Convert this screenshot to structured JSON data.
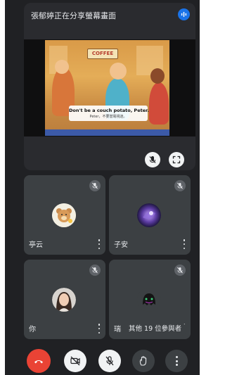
{
  "presentation": {
    "title": "張郁婷正在分享螢幕畫面",
    "shop_sign": "COFFEE",
    "subtitle_en": "Don't be a couch potato, Peter.",
    "subtitle_zh": "Peter，不要當電視迷。"
  },
  "participants": [
    {
      "name": "亭云",
      "avatar": "bear-avatar",
      "mic": "muted"
    },
    {
      "name": "子安",
      "avatar": "galaxy-avatar",
      "mic": "muted"
    },
    {
      "name": "你",
      "avatar": "photo-avatar",
      "mic": "muted"
    },
    {
      "name": "瑞",
      "avatar": "dark-avatar",
      "mic": "muted"
    }
  ],
  "others_label": "其他 19 位參與者",
  "colors": {
    "background": "#202124",
    "tile": "#3c4043",
    "accent_blue": "#1a73e8",
    "hangup_red": "#ea4335"
  },
  "controls": [
    "hangup-icon",
    "camera-off-icon",
    "mic-off-icon",
    "raise-hand-icon",
    "more-options-icon"
  ]
}
